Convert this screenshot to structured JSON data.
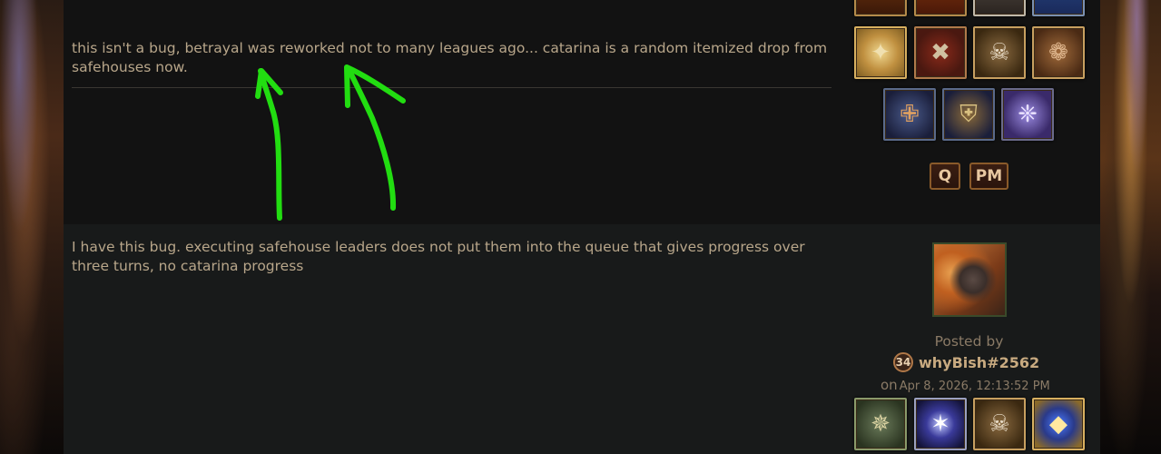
{
  "post1": {
    "text": "this isn't a bug, betrayal was reworked not to many leagues ago... catarina is a random itemized drop from safehouses now.",
    "buttons": {
      "quote": "Q",
      "pm": "PM"
    }
  },
  "post2": {
    "text": "I have this bug. executing safehouse leaders does not put them into the queue that gives progress over three turns, no catarina progress",
    "posted_by_label": "Posted by",
    "level": "34",
    "author": "whyBish#2562",
    "on_label": "on",
    "date": "Apr 8, 2026, 12:13:52 PM"
  },
  "annotation_color": "#22dd11"
}
